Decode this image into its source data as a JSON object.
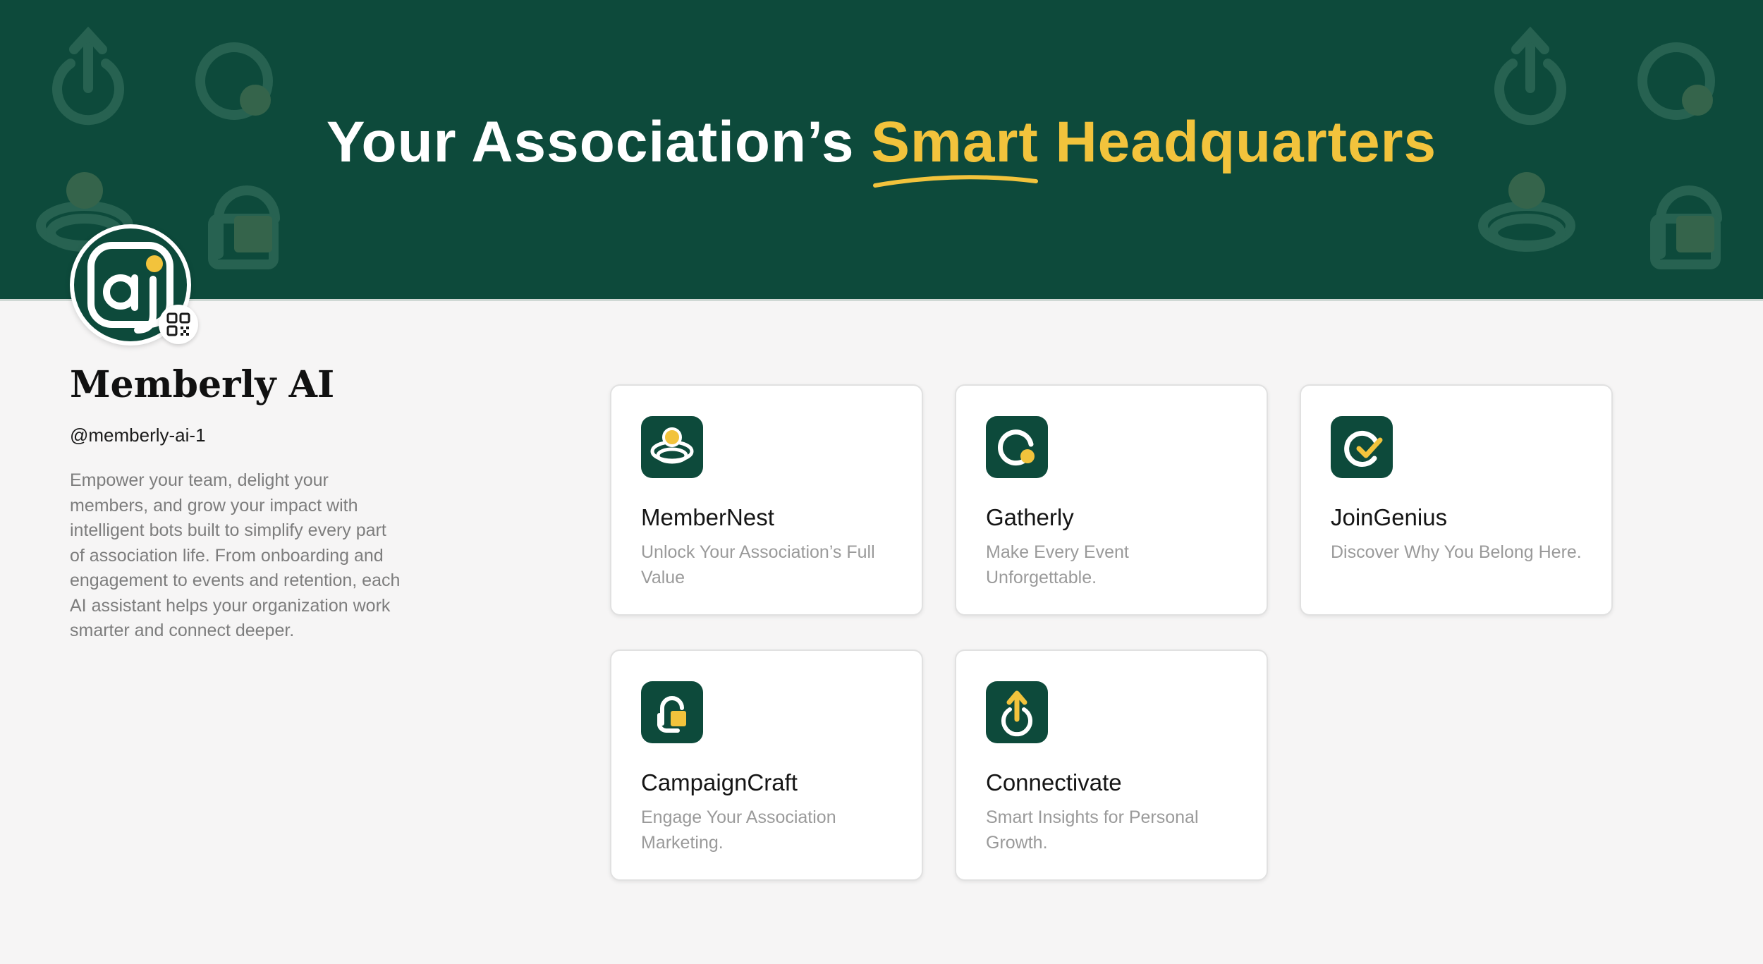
{
  "banner": {
    "headline_part1": "Your Association’s ",
    "headline_smart": "Smart",
    "headline_part2": " Headquarters",
    "background_color": "#0d4a3b",
    "accent_color": "#f2c33c"
  },
  "profile": {
    "name": "Memberly AI",
    "handle": "@memberly-ai-1",
    "description": "Empower your team, delight your members, and grow your impact with intelligent bots built to simplify every part of association life. From onboarding and engagement to events and retention, each AI assistant helps your organization work smarter and connect deeper.",
    "avatar_icon": "memberly-ai-logo",
    "qr_icon": "qr-code-icon"
  },
  "bots": [
    {
      "title": "MemberNest",
      "subtitle": "Unlock Your Association’s Full Value",
      "icon": "member-ring-icon"
    },
    {
      "title": "Gatherly",
      "subtitle": "Make Every Event Unforgettable.",
      "icon": "event-ring-icon"
    },
    {
      "title": "JoinGenius",
      "subtitle": "Discover Why You Belong Here.",
      "icon": "check-ring-icon"
    },
    {
      "title": "CampaignCraft",
      "subtitle": "Engage Your Association Marketing.",
      "icon": "unlock-icon"
    },
    {
      "title": "Connectivate",
      "subtitle": "Smart Insights for Personal Growth.",
      "icon": "arrow-power-icon"
    }
  ]
}
